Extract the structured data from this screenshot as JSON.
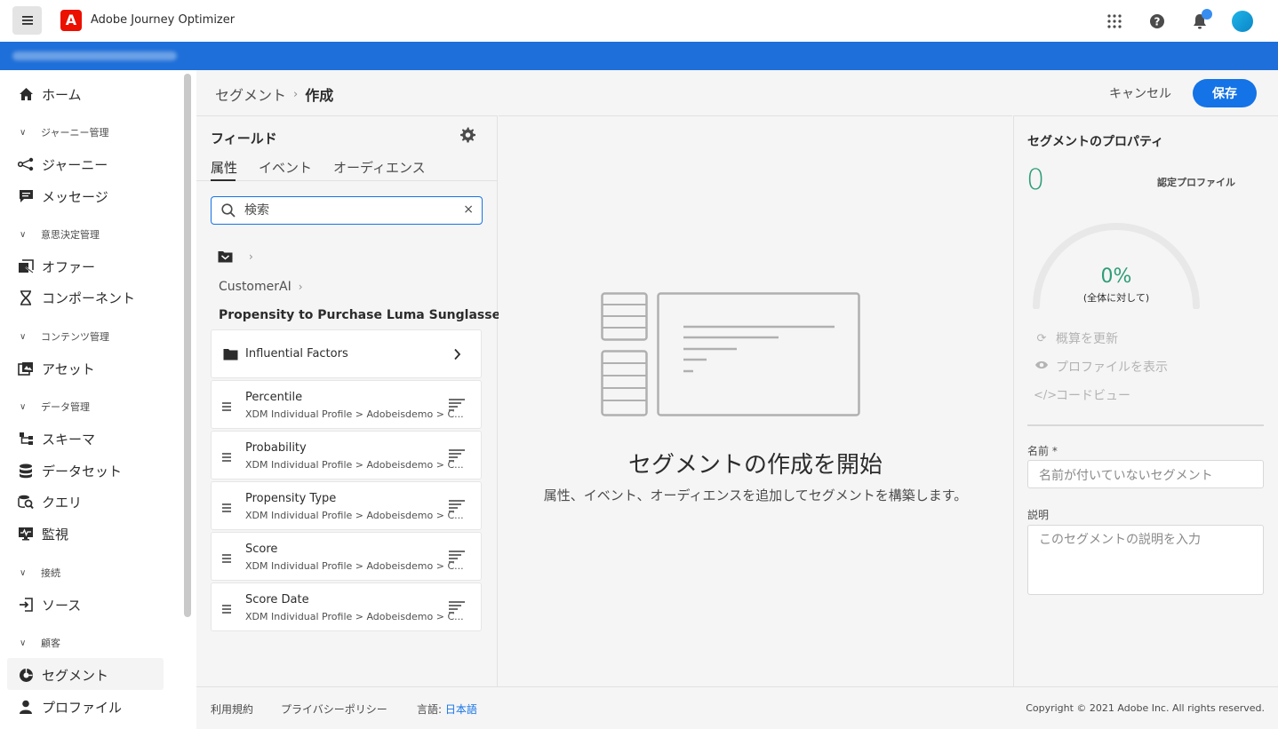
{
  "app": {
    "title": "Adobe Journey Optimizer",
    "logo_letter": "A"
  },
  "nav": {
    "home": "ホーム",
    "groups": {
      "journey_mgmt": "ジャーニー管理",
      "decision_mgmt": "意思決定管理",
      "content_mgmt": "コンテンツ管理",
      "data_mgmt": "データ管理",
      "connections": "接続",
      "customer": "顧客"
    },
    "items": {
      "journeys": "ジャーニー",
      "messages": "メッセージ",
      "offers": "オファー",
      "components": "コンポーネント",
      "assets": "アセット",
      "schemas": "スキーマ",
      "datasets": "データセット",
      "queries": "クエリ",
      "monitoring": "監視",
      "sources": "ソース",
      "segments": "セグメント",
      "profiles": "プロファイル"
    }
  },
  "breadcrumb": {
    "parent": "セグメント",
    "separator": "›",
    "current": "作成"
  },
  "actions": {
    "cancel": "キャンセル",
    "save": "保存"
  },
  "fields_panel": {
    "title": "フィールド",
    "tabs": [
      "属性",
      "イベント",
      "オーディエンス"
    ],
    "search": {
      "value": "検索",
      "clear": "×"
    },
    "path": "CustomerAI",
    "section_title": "Propensity to Purchase Luma Sunglasses",
    "folder": {
      "name": "Influential Factors"
    },
    "attributes": [
      {
        "name": "Percentile",
        "path": "XDM Individual Profile > Adobeisdemo > C..."
      },
      {
        "name": "Probability",
        "path": "XDM Individual Profile > Adobeisdemo > C..."
      },
      {
        "name": "Propensity Type",
        "path": "XDM Individual Profile > Adobeisdemo > C..."
      },
      {
        "name": "Score",
        "path": "XDM Individual Profile > Adobeisdemo > C..."
      },
      {
        "name": "Score Date",
        "path": "XDM Individual Profile > Adobeisdemo > C..."
      }
    ]
  },
  "canvas": {
    "title": "セグメントの作成を開始",
    "subtitle": "属性、イベント、オーディエンスを追加してセグメントを構築します。"
  },
  "properties": {
    "title": "セグメントのプロパティ",
    "count": "0",
    "count_label": "認定プロファイル",
    "gauge_percent": "0%",
    "gauge_label": "(全体に対して)",
    "gauge_value": 0,
    "refresh": "概算を更新",
    "view_profiles": "プロファイルを表示",
    "code_view": "コードビュー",
    "name_label": "名前 *",
    "name_placeholder": "名前が付いていないセグメント",
    "desc_label": "説明",
    "desc_placeholder": "このセグメントの説明を入力"
  },
  "footer": {
    "terms": "利用規約",
    "privacy": "プライバシーポリシー",
    "language_label": "言語:",
    "language_value": "日本語",
    "copyright": "Copyright ©  2021 Adobe Inc.  All rights reserved."
  },
  "colors": {
    "accent": "#1473e6",
    "envbar": "#1e6fd9",
    "success": "#2d9d78",
    "logo": "#eb1000"
  }
}
